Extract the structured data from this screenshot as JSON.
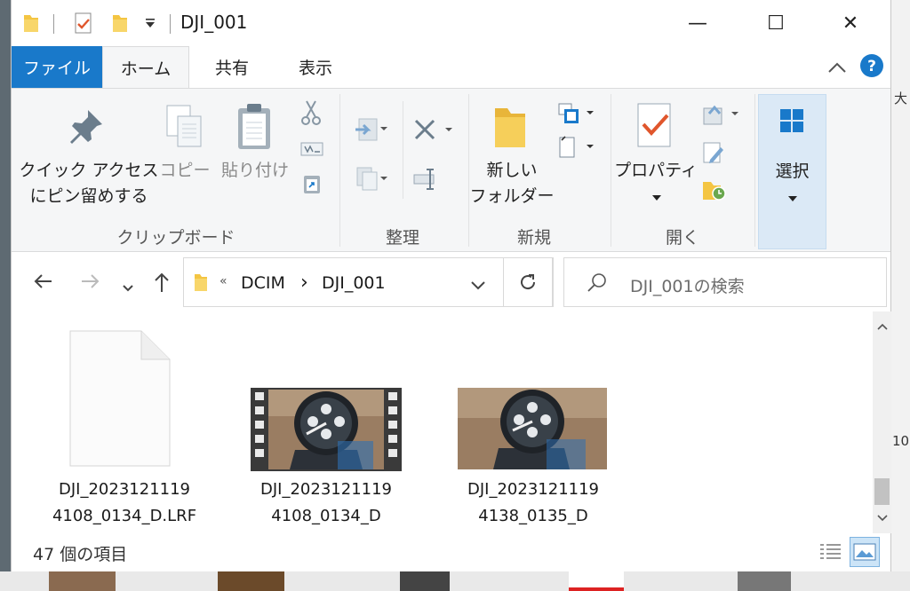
{
  "window": {
    "title": "DJI_001",
    "controls": {
      "minimize": "—",
      "maximize": "☐",
      "close": "✕"
    }
  },
  "ribbon_tabs": {
    "file": "ファイル",
    "home": "ホーム",
    "share": "共有",
    "view": "表示",
    "help": "?"
  },
  "ribbon": {
    "clipboard": {
      "group_label": "クリップボード",
      "pin_line1": "クイック アクセス",
      "pin_line2": "にピン留めする",
      "copy": "コピー",
      "paste": "貼り付け"
    },
    "organize": {
      "group_label": "整理"
    },
    "new": {
      "group_label": "新規",
      "new_folder_line1": "新しい",
      "new_folder_line2": "フォルダー"
    },
    "open": {
      "group_label": "開く",
      "properties": "プロパティ"
    },
    "select": {
      "label": "選択"
    }
  },
  "address": {
    "overflow": "«",
    "breadcrumb": [
      "DCIM",
      "DJI_001"
    ],
    "separator": "›"
  },
  "search": {
    "placeholder": "DJI_001の検索"
  },
  "files": [
    {
      "line1": "DJI_2023121119",
      "line2": "4108_0134_D.LRF",
      "kind": "blank-file"
    },
    {
      "line1": "DJI_2023121119",
      "line2": "4108_0134_D",
      "kind": "video"
    },
    {
      "line1": "DJI_2023121119",
      "line2": "4138_0135_D",
      "kind": "image"
    }
  ],
  "status": {
    "item_count": "47 個の項目"
  },
  "desktop": {
    "right_text_1": "大",
    "right_text_2": "10"
  },
  "colors": {
    "accent": "#1979ca",
    "select_bg": "#dbe9f6",
    "folder": "#f4c542"
  }
}
